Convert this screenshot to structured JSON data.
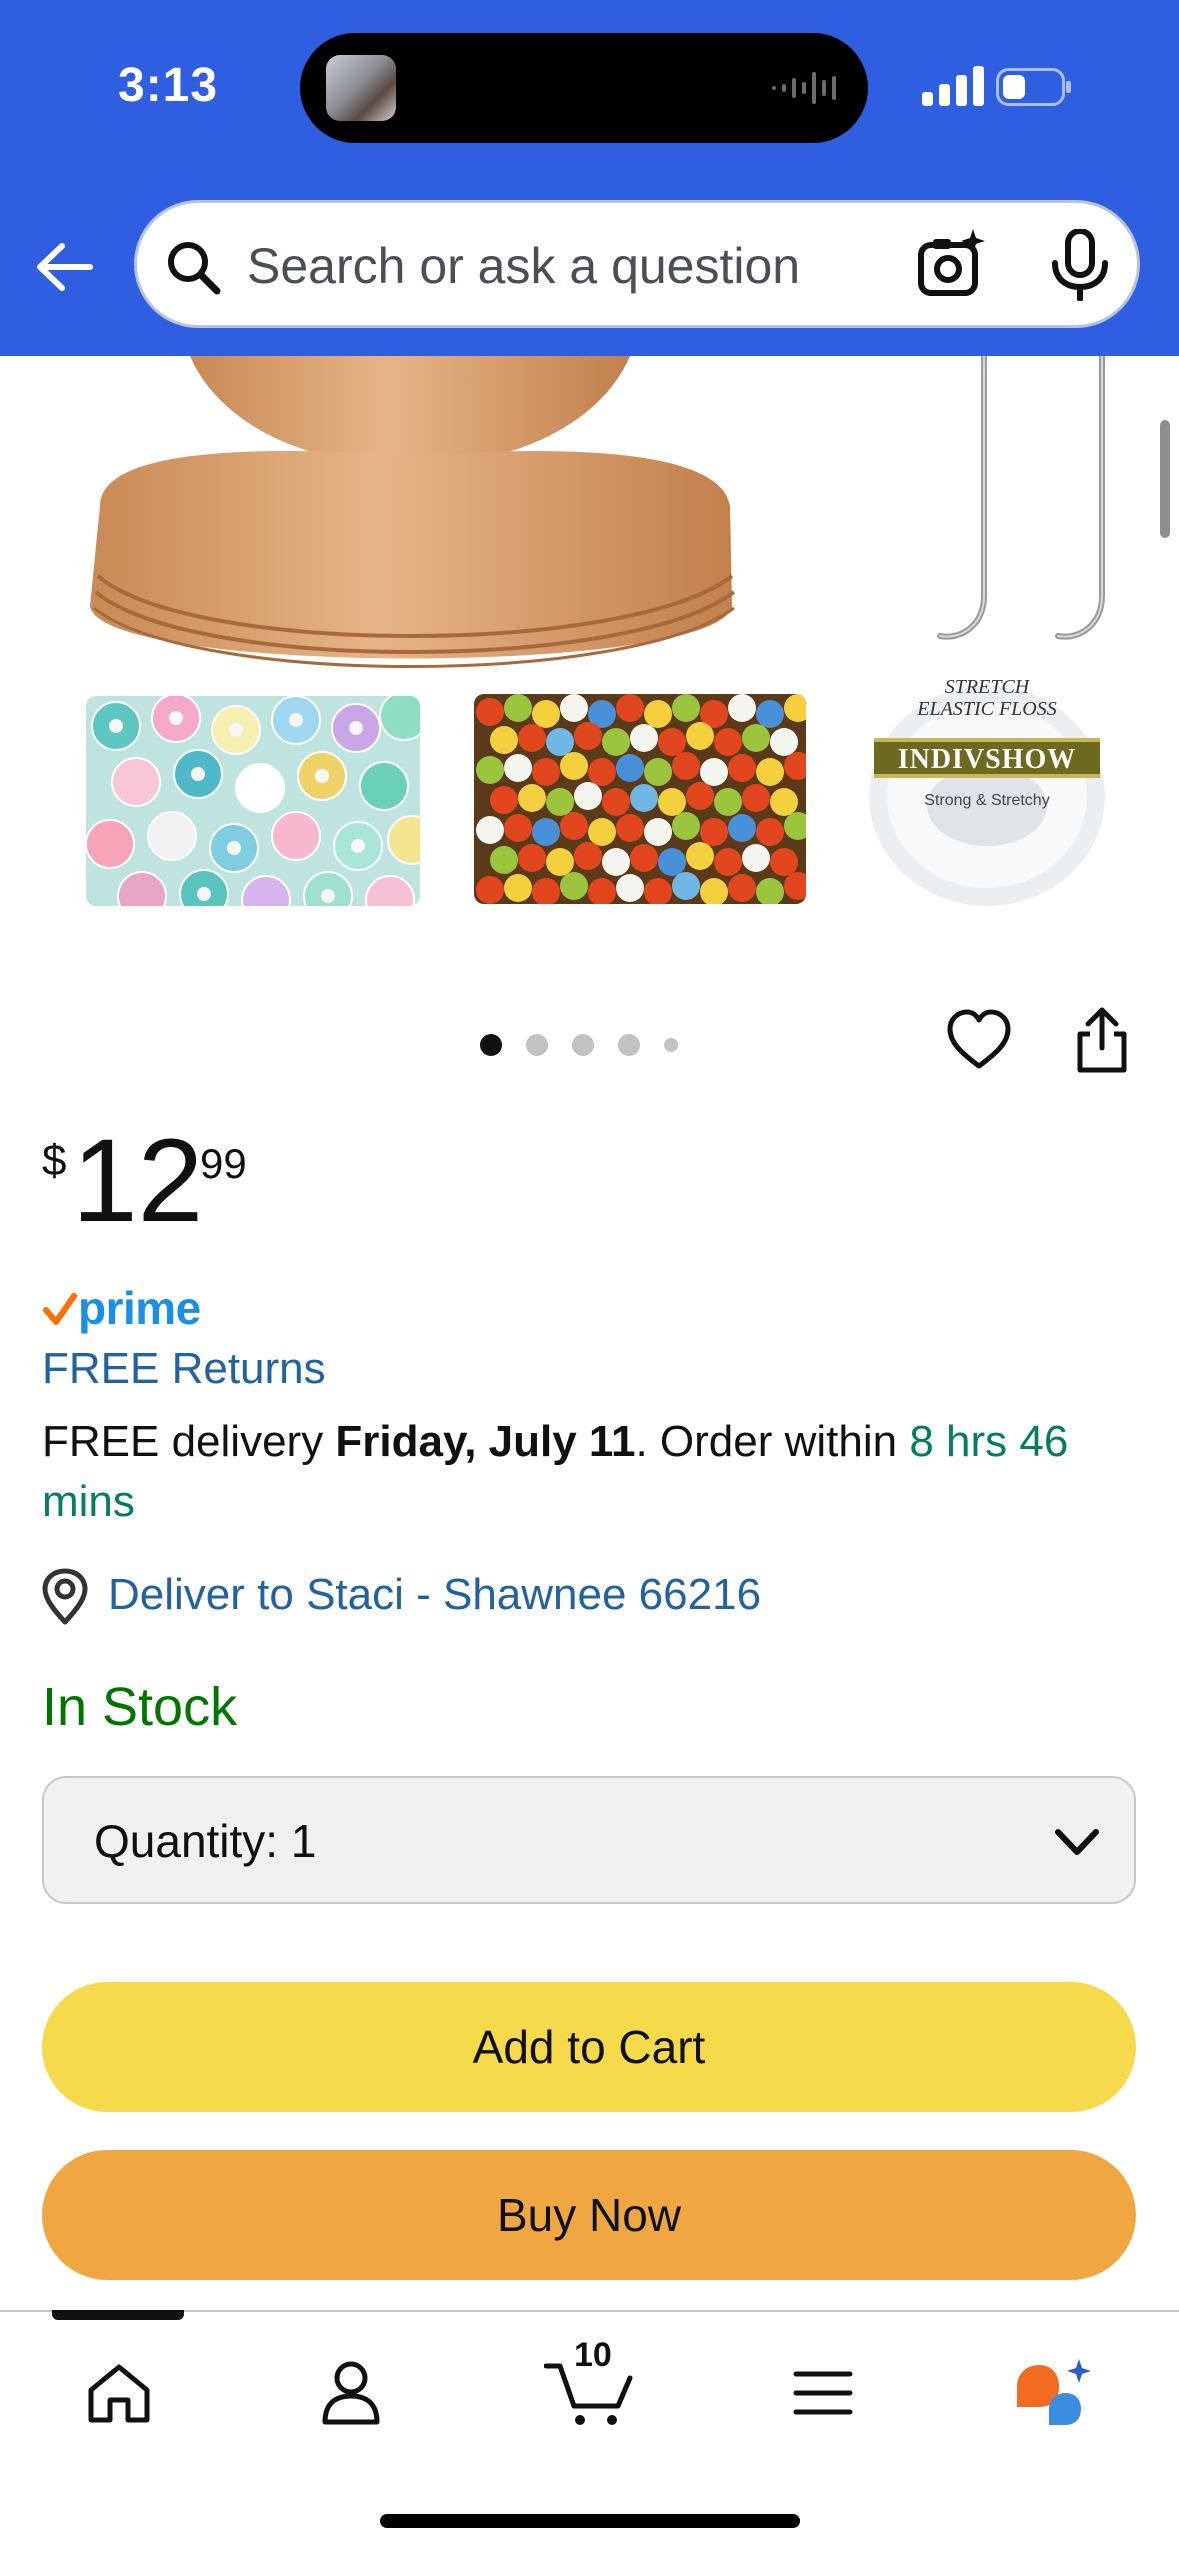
{
  "status_bar": {
    "time": "3:13"
  },
  "search": {
    "placeholder": "Search or ask a question"
  },
  "carousel": {
    "dots": 5,
    "active_index": 0
  },
  "product": {
    "price_symbol": "$",
    "price_whole": "12",
    "price_fraction": "99",
    "prime": "prime",
    "free_returns": "FREE Returns",
    "delivery": {
      "prefix": "FREE delivery ",
      "date": "Friday, July 11",
      "middle": ". Order within ",
      "countdown": "8 hrs 46 mins"
    },
    "deliver_to": "Deliver to Staci - Shawnee 66216",
    "stock": "In Stock",
    "quantity_label": "Quantity:",
    "quantity_value": "1",
    "add_to_cart": "Add to Cart",
    "buy_now": "Buy Now"
  },
  "floss_label": {
    "line1": "STRETCH",
    "line2": "ELASTIC FLOSS",
    "brand": "INDIVSHOW",
    "subtitle": "Strong & Stretchy"
  },
  "tabbar": {
    "cart_count": "10",
    "items": [
      "home",
      "account",
      "cart",
      "menu",
      "rufus"
    ]
  },
  "colors": {
    "header": "#2f5fe0",
    "add_to_cart": "#f7d94c",
    "buy_now": "#f0a741",
    "in_stock": "#007600",
    "link": "#2162a1",
    "countdown": "#067d62"
  }
}
